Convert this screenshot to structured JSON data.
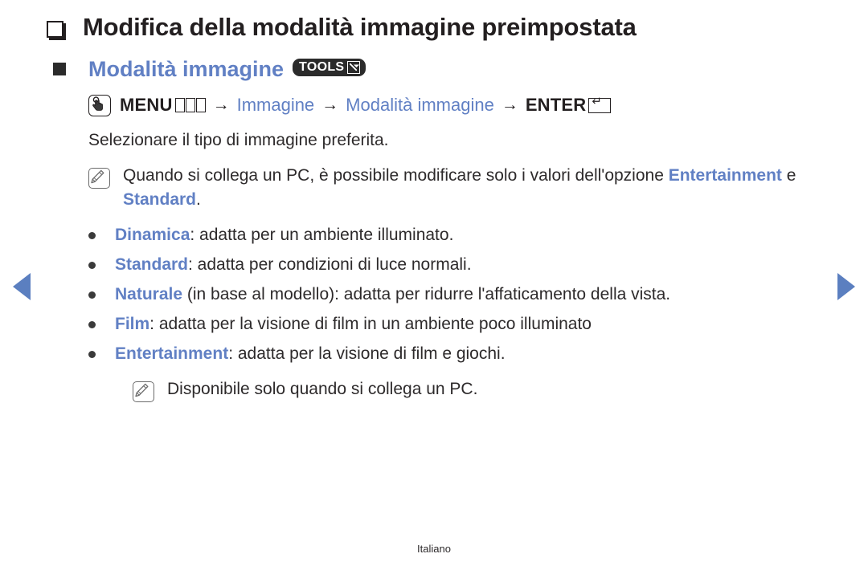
{
  "page": {
    "title": "Modifica della modalità immagine preimpostata",
    "footer": "Italiano",
    "accent_blue": "#6180c4",
    "text_color": "#2d2a2b"
  },
  "nav": {
    "prev_icon": "triangle-left-icon",
    "next_icon": "triangle-right-icon"
  },
  "section": {
    "heading": "Modalità immagine",
    "badge": {
      "label": "TOOLS",
      "icon": "external-link-icon"
    }
  },
  "menu_path": {
    "press_icon": "hand-press-icon",
    "menu_label": "MENU",
    "menu_icon": "menu-grid-icon",
    "arrow": "→",
    "step1": "Immagine",
    "step2": "Modalità immagine",
    "enter_label": "ENTER",
    "enter_icon": "enter-key-icon"
  },
  "intro": "Selezionare il tipo di immagine preferita.",
  "note_top": {
    "icon": "note-pencil-icon",
    "text_part1": "Quando si collega un PC, è possibile modificare solo i valori dell'opzione ",
    "kw1": "Entertainment",
    "text_part2": " e ",
    "kw2": "Standard",
    "text_part3": "."
  },
  "options": [
    {
      "keyword": "Dinamica",
      "description": ": adatta per un ambiente illuminato."
    },
    {
      "keyword": "Standard",
      "description": ": adatta per condizioni di luce normali."
    },
    {
      "keyword": "Naturale",
      "description": " (in base al modello): adatta per ridurre l'affaticamento della vista."
    },
    {
      "keyword": "Film",
      "description": ": adatta per la visione di film in un ambiente poco illuminato"
    },
    {
      "keyword": "Entertainment",
      "description": ": adatta per la visione di film e giochi."
    }
  ],
  "note_bottom": {
    "icon": "note-pencil-icon",
    "text": "Disponibile solo quando si collega un PC."
  }
}
